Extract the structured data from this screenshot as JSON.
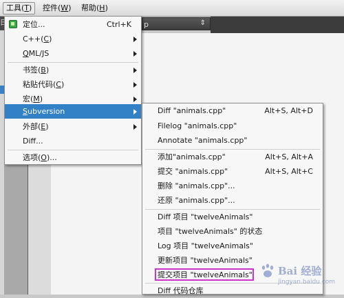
{
  "menubar": [
    {
      "label": "工具(",
      "mnemonic": "T",
      "suffix": ")",
      "active": true
    },
    {
      "label": "控件(",
      "mnemonic": "W",
      "suffix": ")",
      "active": false
    },
    {
      "label": "帮助(",
      "mnemonic": "H",
      "suffix": ")",
      "active": false
    }
  ],
  "background": {
    "combo_text": "p",
    "tab_text": "日"
  },
  "tools_menu": {
    "locate": {
      "label": "定位...",
      "shortcut": "Ctrl+K"
    },
    "cpp": {
      "pre": "C++(",
      "mn": "C",
      "post": ")"
    },
    "qml": {
      "mn": "Q",
      "post": "ML/JS"
    },
    "bookmark": {
      "pre": "书签(",
      "mn": "B",
      "post": ")"
    },
    "paste": {
      "pre": "粘贴代码(",
      "mn": "C",
      "post": ")"
    },
    "macro": {
      "pre": "宏(",
      "mn": "M",
      "post": ")"
    },
    "subversion": {
      "mn": "S",
      "post": "ubversion"
    },
    "external": {
      "pre": "外部(",
      "mn": "E",
      "post": ")"
    },
    "diff": {
      "label": "Diff..."
    },
    "options": {
      "pre": "选项(",
      "mn": "O",
      "post": ")..."
    }
  },
  "subversion_menu": [
    {
      "label": "Diff \"animals.cpp\"",
      "shortcut": "Alt+S, Alt+D"
    },
    {
      "label": "Filelog \"animals.cpp\"",
      "shortcut": ""
    },
    {
      "label": "Annotate \"animals.cpp\"",
      "shortcut": ""
    },
    {
      "label": "添加\"animals.cpp\"",
      "shortcut": "Alt+S, Alt+A"
    },
    {
      "label": "提交 \"animals.cpp\"",
      "shortcut": "Alt+S, Alt+C"
    },
    {
      "label": "删除 \"animals.cpp\"...",
      "shortcut": ""
    },
    {
      "label": "还原 \"animals.cpp\"...",
      "shortcut": ""
    },
    {
      "label": "Diff 项目 \"twelveAnimals\"",
      "shortcut": ""
    },
    {
      "label": "项目 \"twelveAnimals\" 的状态",
      "shortcut": ""
    },
    {
      "label": "Log 项目 \"twelveAnimals\"",
      "shortcut": ""
    },
    {
      "label": "更新项目 \"twelveAnimals\"",
      "shortcut": ""
    },
    {
      "label": "提交项目 \"twelveAnimals\"",
      "shortcut": ""
    },
    {
      "label": "Diff 代码仓库",
      "shortcut": ""
    }
  ],
  "watermark": {
    "title": "Bai 经验",
    "sub": "jingyan.baidu.com"
  },
  "colors": {
    "highlight": "#3281c6",
    "annotation": "#cc33cc"
  }
}
